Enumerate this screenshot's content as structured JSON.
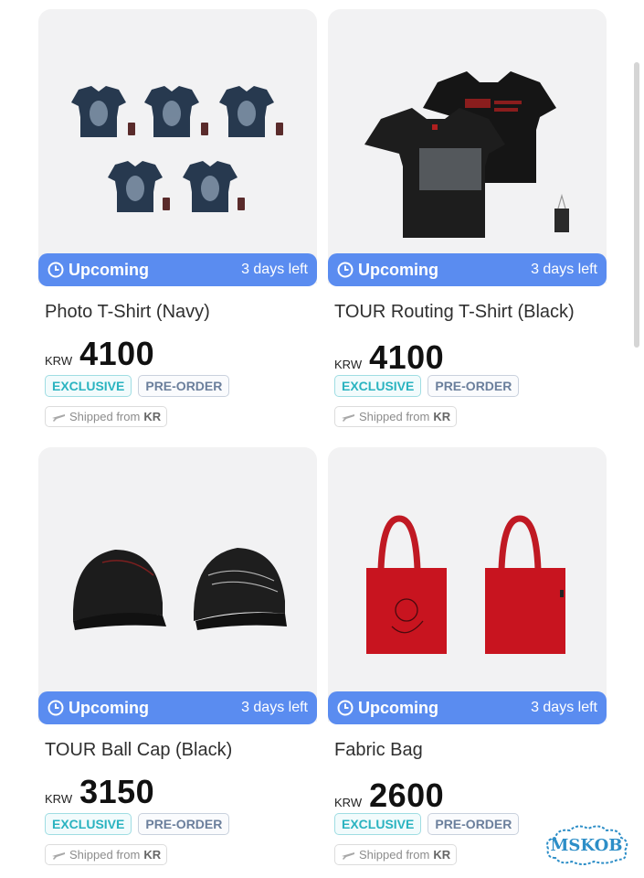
{
  "colors": {
    "accent": "#5a8cf0",
    "exclusive": "#2ab3c0",
    "preorder": "#6b7f9c"
  },
  "products": [
    {
      "title": "Photo T-Shirt (Navy)",
      "currency": "KRW",
      "price": "4100",
      "status": "Upcoming",
      "days_left": "3 days left",
      "badges": [
        "EXCLUSIVE",
        "PRE-ORDER"
      ],
      "shipped_prefix": "Shipped from",
      "shipped_country": "KR",
      "image_icon": "navy-tshirt-image"
    },
    {
      "title": "TOUR Routing T-Shirt (Black)",
      "currency": "KRW",
      "price": "4100",
      "status": "Upcoming",
      "days_left": "3 days left",
      "badges": [
        "EXCLUSIVE",
        "PRE-ORDER"
      ],
      "shipped_prefix": "Shipped from",
      "shipped_country": "KR",
      "image_icon": "black-tshirt-image"
    },
    {
      "title": "TOUR Ball Cap (Black)",
      "currency": "KRW",
      "price": "3150",
      "status": "Upcoming",
      "days_left": "3 days left",
      "badges": [
        "EXCLUSIVE",
        "PRE-ORDER"
      ],
      "shipped_prefix": "Shipped from",
      "shipped_country": "KR",
      "image_icon": "ball-cap-image"
    },
    {
      "title": "Fabric Bag",
      "currency": "KRW",
      "price": "2600",
      "status": "Upcoming",
      "days_left": "3 days left",
      "badges": [
        "EXCLUSIVE",
        "PRE-ORDER"
      ],
      "shipped_prefix": "Shipped from",
      "shipped_country": "KR",
      "image_icon": "tote-bag-image"
    }
  ],
  "watermark": {
    "text": "MSKOB"
  }
}
